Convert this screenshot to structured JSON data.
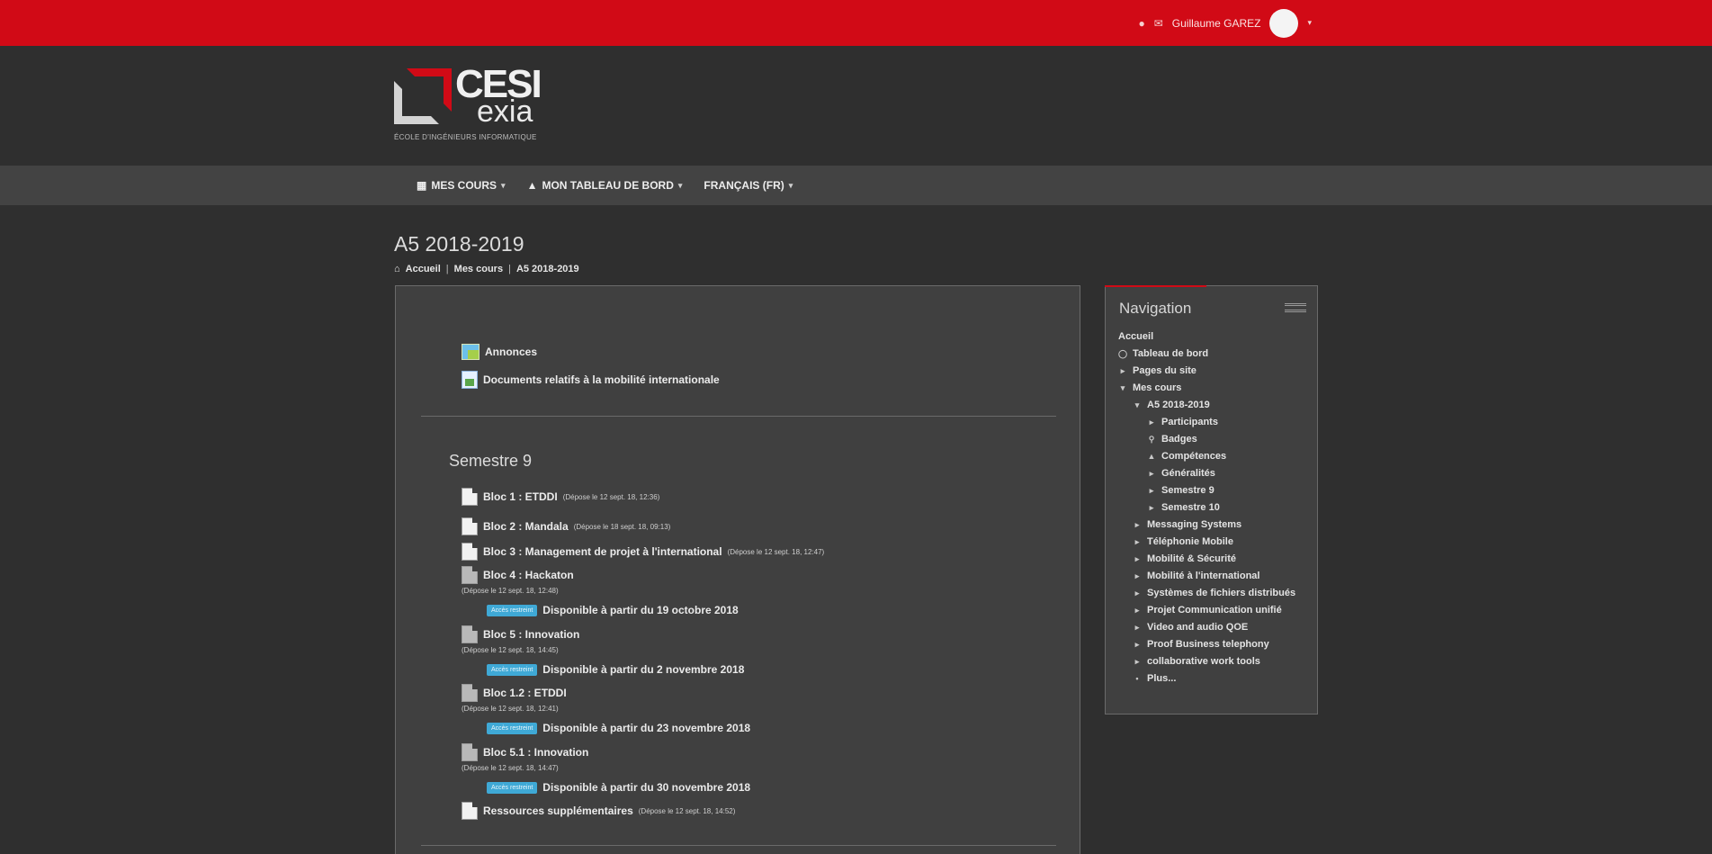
{
  "topbar": {
    "user_name": "Guillaume GAREZ"
  },
  "logo": {
    "text_main": "CESI",
    "text_sub": "exia",
    "tagline": "ÉCOLE D'INGÉNIEURS INFORMATIQUE"
  },
  "navbar": {
    "items": [
      {
        "label": "MES COURS"
      },
      {
        "label": "MON TABLEAU DE BORD"
      },
      {
        "label": "FRANÇAIS (FR)"
      }
    ]
  },
  "page": {
    "title": "A5 2018-2019",
    "breadcrumb": [
      "Accueil",
      "Mes cours",
      "A5 2018-2019"
    ]
  },
  "main": {
    "top_resources": [
      {
        "label": "Annonces",
        "icon": "forum-icon"
      },
      {
        "label": "Documents relatifs à la mobilité internationale",
        "icon": "file-icon"
      }
    ],
    "section_title": "Semestre 9",
    "blocks": [
      {
        "label": "Bloc 1 : ETDDI",
        "meta": "(Dépose le 12 sept. 18, 12:36)"
      },
      {
        "label": "Bloc 2 : Mandala",
        "meta": "(Dépose le 18 sept. 18, 09:13)"
      },
      {
        "label": "Bloc 3 : Management de projet à l'international",
        "meta": "(Dépose le 12 sept. 18, 12:47)"
      },
      {
        "label": "Bloc 4 : Hackaton",
        "meta": "(Dépose le 12 sept. 18, 12:48)",
        "badge": "Accès restreint",
        "restriction": "Disponible à partir du 19 octobre 2018"
      },
      {
        "label": "Bloc 5 : Innovation",
        "meta": "(Dépose le 12 sept. 18, 14:45)",
        "badge": "Accès restreint",
        "restriction": "Disponible à partir du 2 novembre 2018"
      },
      {
        "label": "Bloc 1.2 : ETDDI",
        "meta": "(Dépose le 12 sept. 18, 12:41)",
        "badge": "Accès restreint",
        "restriction": "Disponible à partir du 23 novembre 2018"
      },
      {
        "label": "Bloc 5.1 : Innovation",
        "meta": "(Dépose le 12 sept. 18, 14:47)",
        "badge": "Accès restreint",
        "restriction": "Disponible à partir du 30 novembre 2018"
      },
      {
        "label": "Ressources supplémentaires",
        "meta": "(Dépose le 12 sept. 18, 14:52)"
      }
    ]
  },
  "navigation": {
    "title": "Navigation",
    "items": [
      {
        "label": "Accueil"
      },
      {
        "label": "Tableau de bord"
      },
      {
        "label": "Pages du site"
      },
      {
        "label": "Mes cours"
      },
      {
        "label": "A5 2018-2019"
      },
      {
        "label": "Participants"
      },
      {
        "label": "Badges"
      },
      {
        "label": "Compétences"
      },
      {
        "label": "Généralités"
      },
      {
        "label": "Semestre 9"
      },
      {
        "label": "Semestre 10"
      },
      {
        "label": "Messaging Systems"
      },
      {
        "label": "Téléphonie Mobile"
      },
      {
        "label": "Mobilité & Sécurité"
      },
      {
        "label": "Mobilité à l'international"
      },
      {
        "label": "Systèmes de fichiers distribués"
      },
      {
        "label": "Projet Communication unifié"
      },
      {
        "label": "Video and audio QOE"
      },
      {
        "label": "Proof Business telephony"
      },
      {
        "label": "collaborative work tools"
      },
      {
        "label": "Plus..."
      }
    ]
  }
}
